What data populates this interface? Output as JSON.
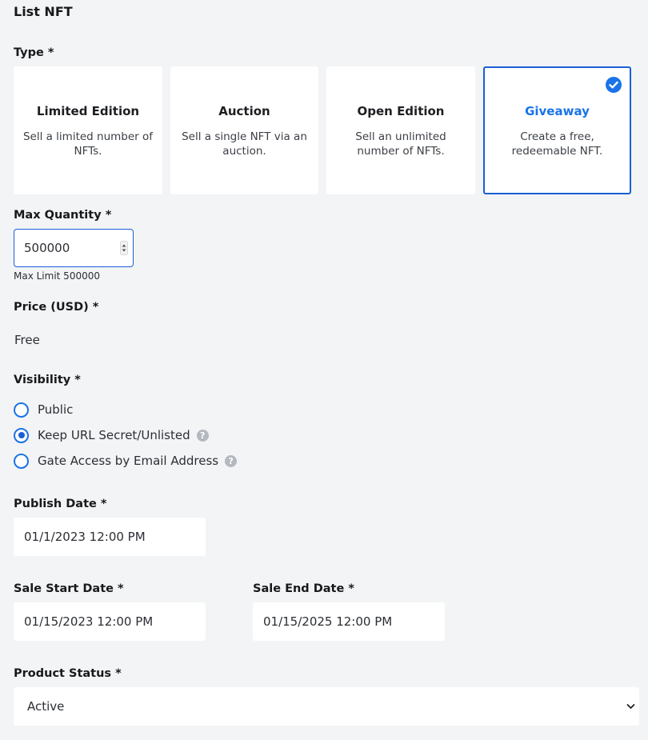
{
  "page": {
    "title": "List NFT"
  },
  "type": {
    "label": "Type *",
    "options": [
      {
        "title": "Limited Edition",
        "desc": "Sell a limited number of NFTs."
      },
      {
        "title": "Auction",
        "desc": "Sell a single NFT via an auction."
      },
      {
        "title": "Open Edition",
        "desc": "Sell an unlimited number of NFTs."
      },
      {
        "title": "Giveaway",
        "desc": "Create a free, redeemable NFT.",
        "selected": true
      }
    ]
  },
  "max_quantity": {
    "label": "Max Quantity *",
    "value": "500000",
    "hint": "Max Limit 500000"
  },
  "price": {
    "label": "Price (USD) *",
    "value": "Free"
  },
  "visibility": {
    "label": "Visibility *",
    "options": [
      {
        "label": "Public",
        "selected": false
      },
      {
        "label": "Keep URL Secret/Unlisted",
        "selected": true,
        "help": "?"
      },
      {
        "label": "Gate Access by Email Address",
        "selected": false,
        "help": "?"
      }
    ]
  },
  "publish_date": {
    "label": "Publish Date *",
    "value": "01/1/2023 12:00 PM"
  },
  "sale_start": {
    "label": "Sale Start Date *",
    "value": "01/15/2023 12:00 PM"
  },
  "sale_end": {
    "label": "Sale End Date *",
    "value": "01/15/2025 12:00 PM"
  },
  "product_status": {
    "label": "Product Status *",
    "value": "Active"
  },
  "colors": {
    "accent": "#1a73e8",
    "background": "#f3f4f6"
  }
}
